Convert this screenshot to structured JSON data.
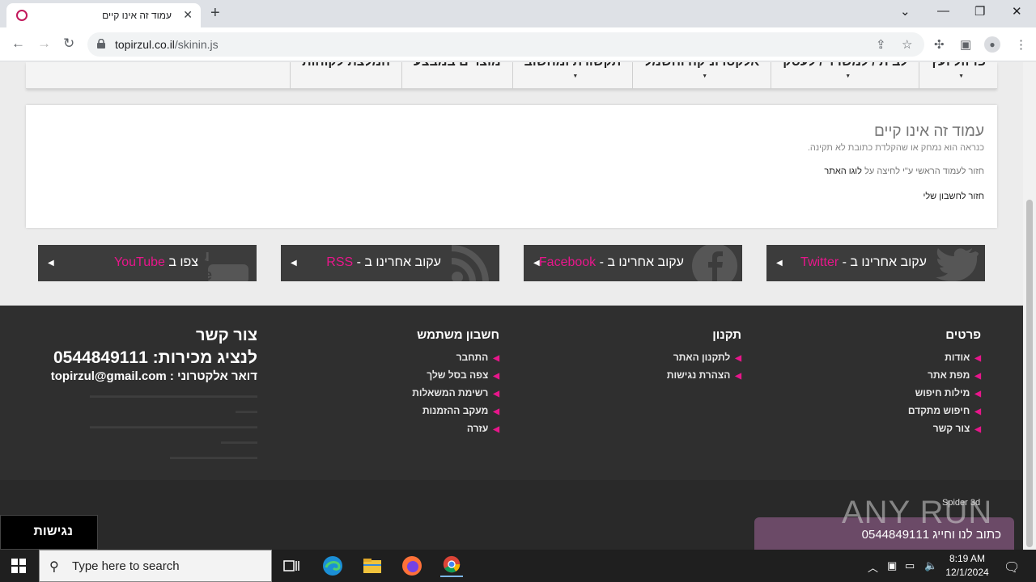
{
  "browser": {
    "tab_title": "עמוד זה אינו קיים",
    "tab_close": "✕",
    "new_tab": "+",
    "url_host": "topirzul.co.il",
    "url_path": "/skinin.js",
    "controls": {
      "dropdown": "⌄",
      "minimize": "—",
      "restore": "❐",
      "close": "✕"
    }
  },
  "site": {
    "menu": [
      {
        "label": "פרזול ועץ",
        "dropdown": true
      },
      {
        "label": "לבית / למשרד / לעסק",
        "dropdown": true
      },
      {
        "label": "אלקטרוניקה וחשמל",
        "dropdown": true
      },
      {
        "label": "תקשורת ומחשוב",
        "dropdown": true
      },
      {
        "label": "מוצרים במבצע",
        "dropdown": false
      },
      {
        "label": "המלצת לקוחות",
        "dropdown": false
      }
    ],
    "notfound": {
      "title": "עמוד זה אינו קיים",
      "subtitle": "כנראה הוא נמחק או שהקלדת כתובת לא תקינה.",
      "home_text": "חזור לעמוד הראשי ע\"י לחיצה על",
      "home_link": "לוגו האתר",
      "account_link": "חזור לחשבון שלי"
    },
    "social": [
      {
        "prefix": "עקוב אחרינו ב - ",
        "name": "Twitter",
        "icon": "twitter-icon"
      },
      {
        "prefix": "עקוב אחרינו ב - ",
        "name": "Facebook",
        "icon": "facebook-icon"
      },
      {
        "prefix": "עקוב אחרינו ב - ",
        "name": "RSS",
        "icon": "rss-icon"
      },
      {
        "prefix": "צפו ב ",
        "name": "YouTube",
        "icon": "youtube-icon"
      }
    ],
    "footer": {
      "col_details": {
        "title": "פרטים",
        "items": [
          "אודות",
          "מפת אתר",
          "מילות חיפוש",
          "חיפוש מתקדם",
          "צור קשר"
        ]
      },
      "col_terms": {
        "title": "תקנון",
        "items": [
          "לתקנון האתר",
          "הצהרת נגישות"
        ]
      },
      "col_account": {
        "title": "חשבון משתמש",
        "items": [
          "התחבר",
          "צפה בסל שלך",
          "רשימת המשאלות",
          "מעקב ההזמנות",
          "עזרה"
        ]
      },
      "contact": {
        "title": "צור קשר",
        "phone": "לנציג מכירות: 0544849111",
        "email": "דואר אלקטרוני : topirzul@gmail.com"
      }
    },
    "spider": "Spider 3d",
    "whatsapp": "כתוב לנו וחייג 0544849111",
    "watermark": "ANY RUN",
    "accessibility": "נגישות"
  },
  "taskbar": {
    "search_placeholder": "Type here to search",
    "time": "8:19 AM",
    "date": "12/1/2024"
  },
  "colors": {
    "accent_pink": "#e8168b",
    "footer_bg": "#2f2f2f",
    "social_bg": "#3c3c3c"
  }
}
